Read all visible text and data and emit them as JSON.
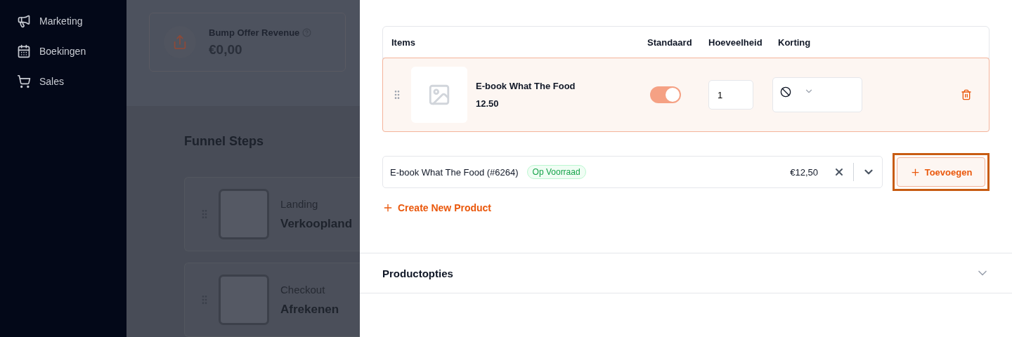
{
  "sidebar": {
    "items": [
      {
        "label": "Marketing",
        "kind": "megaphone"
      },
      {
        "label": "Boekingen",
        "kind": "calendar"
      },
      {
        "label": "Sales",
        "kind": "cart"
      }
    ]
  },
  "stat_card": {
    "label": "Bump Offer Revenue",
    "value": "€0,00"
  },
  "funnel": {
    "title": "Funnel Steps",
    "steps": [
      {
        "type": "Landing",
        "name": "Verkoopland"
      },
      {
        "type": "Checkout",
        "name": "Afrekenen"
      }
    ]
  },
  "items_table": {
    "columns": [
      "Items",
      "Standaard",
      "Hoeveelheid",
      "Korting"
    ],
    "rows": [
      {
        "name": "E-book What The Food",
        "price": "12.50",
        "default": true,
        "quantity": "1"
      }
    ]
  },
  "product_select": {
    "value": "E-book What The Food (#6264)",
    "badge": "Op Voorraad",
    "price": "€12,50"
  },
  "add_button": {
    "label": "Toevoegen",
    "highlighted": true
  },
  "create_link": "Create New Product",
  "section": {
    "title": "Productopties",
    "expanded": false
  }
}
